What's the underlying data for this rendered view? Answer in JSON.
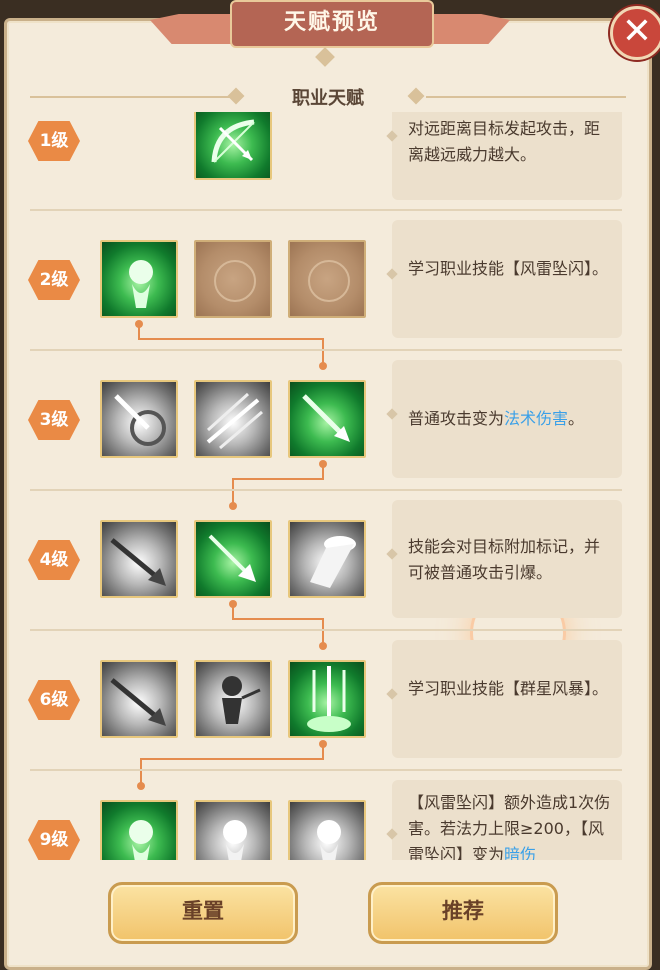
{
  "header": {
    "title": "天赋预览",
    "close_icon": "close-icon"
  },
  "section": {
    "title": "职业天赋"
  },
  "rows": [
    {
      "level": "1级",
      "icons": [
        "bow-icon"
      ],
      "desc": "对远距离目标发起攻击，距离越远威力越大。"
    },
    {
      "level": "2级",
      "icons": [
        "wind-thunder-figure-icon",
        "locked-slot-icon",
        "locked-slot-icon"
      ],
      "desc": "学习职业技能【风雷坠闪】。"
    },
    {
      "level": "3级",
      "icons": [
        "arrow-target-icon",
        "triple-arrow-icon",
        "green-arrow-strike-icon"
      ],
      "desc_prefix": "普通攻击变为",
      "desc_highlight": "法术伤害",
      "desc_suffix": "。"
    },
    {
      "level": "4级",
      "icons": [
        "spear-strike-icon",
        "green-arrow-burst-icon",
        "light-beam-icon"
      ],
      "desc": "技能会对目标附加标记，并可被普通攻击引爆。"
    },
    {
      "level": "6级",
      "icons": [
        "spear-strike-icon",
        "archer-figure-icon",
        "star-arrow-rain-icon"
      ],
      "desc": "学习职业技能【群星风暴】。"
    },
    {
      "level": "9级",
      "icons": [
        "wind-thunder-figure-icon",
        "gray-figure-icon",
        "gray-figure-icon"
      ],
      "desc_line1": "【风雷坠闪】额外造成1次伤害。若法力上限≥200，",
      "desc_line2_prefix": "【风雷坠闪】变为",
      "desc_line2_highlight": "暗伤"
    }
  ],
  "buttons": {
    "reset": "重置",
    "recommend": "推荐"
  },
  "colors": {
    "accent": "#ea8a45",
    "highlight": "#3aa0e8",
    "close": "#c9473b"
  }
}
